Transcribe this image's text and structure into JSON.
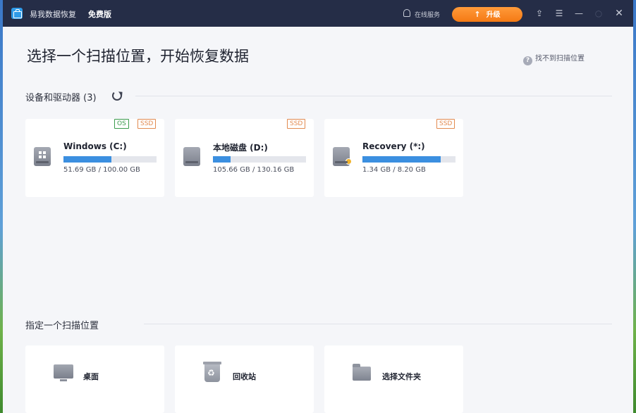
{
  "titlebar": {
    "app_name": "易我数据恢复",
    "edition": "免费版",
    "support_label": "在线服务",
    "upgrade_label": "升级",
    "icons": [
      "upload-icon",
      "menu-icon",
      "minimize-icon",
      "maximize-icon",
      "close-icon"
    ]
  },
  "main": {
    "title": "选择一个扫描位置，开始恢复数据",
    "help_label": "找不到扫描位置",
    "devices_section": "设备和驱动器 (3)",
    "locations_section": "指定一个扫描位置"
  },
  "drives": [
    {
      "name": "Windows (C:)",
      "size": "51.69 GB / 100.00 GB",
      "used_fraction": 0.517,
      "tags": [
        "OS",
        "SSD"
      ],
      "icon": "windows-drive-icon"
    },
    {
      "name": "本地磁盘 (D:)",
      "size": "105.66 GB / 130.16 GB",
      "used_fraction": 0.19,
      "tags": [
        "SSD"
      ],
      "icon": "hard-drive-icon"
    },
    {
      "name": "Recovery (*:)",
      "size": "1.34 GB / 8.20 GB",
      "used_fraction": 0.84,
      "tags": [
        "SSD"
      ],
      "icon": "locked-drive-icon"
    }
  ],
  "locations": [
    {
      "label": "桌面",
      "icon": "desktop-icon"
    },
    {
      "label": "回收站",
      "icon": "recycle-bin-icon"
    },
    {
      "label": "选择文件夹",
      "icon": "folder-icon"
    }
  ],
  "colors": {
    "titlebar": "#252d47",
    "accent": "#3b8fe0",
    "upgrade": "#f57a14",
    "tag_os": "#3a9b4c",
    "tag_ssd": "#e28a4f"
  }
}
